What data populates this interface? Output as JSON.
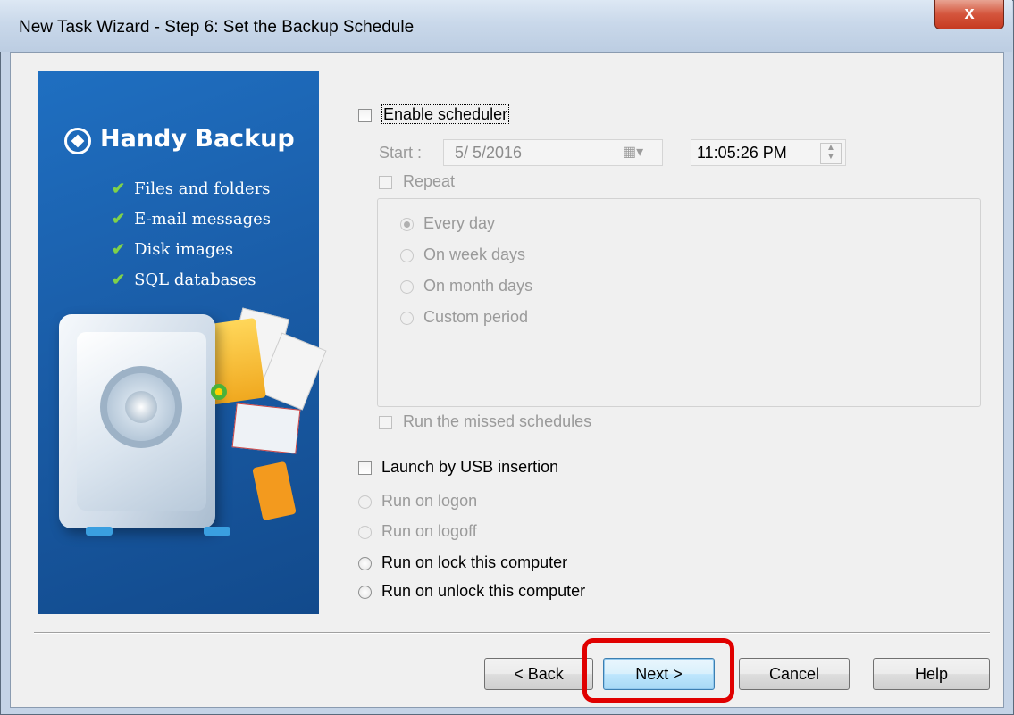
{
  "window": {
    "title": "New Task Wizard - Step 6: Set the Backup Schedule",
    "close_glyph": "x"
  },
  "banner": {
    "brand": "Handy Backup",
    "features": [
      "Files and folders",
      "E-mail messages",
      "Disk images",
      "SQL databases"
    ],
    "check_glyph": "✔"
  },
  "scheduler": {
    "enable_label": "Enable scheduler",
    "enabled": false,
    "start_label": "Start :",
    "start_date": "5/ 5/2016",
    "start_time": "11:05:26 PM",
    "repeat_label": "Repeat",
    "repeat_options": [
      "Every day",
      "On week days",
      "On month days",
      "Custom period"
    ],
    "repeat_selected": "Every day",
    "missed_label": "Run the missed schedules"
  },
  "triggers": {
    "usb_label": "Launch by USB insertion",
    "options": [
      "Run on logon",
      "Run on logoff",
      "Run on lock this computer",
      "Run on unlock this computer"
    ]
  },
  "buttons": {
    "back": "< Back",
    "next": "Next >",
    "cancel": "Cancel",
    "help": "Help"
  },
  "colors": {
    "banner_blue": "#1a5da8",
    "check_green": "#7fd14a",
    "highlight_red": "#e00000",
    "close_red": "#c63a22"
  }
}
